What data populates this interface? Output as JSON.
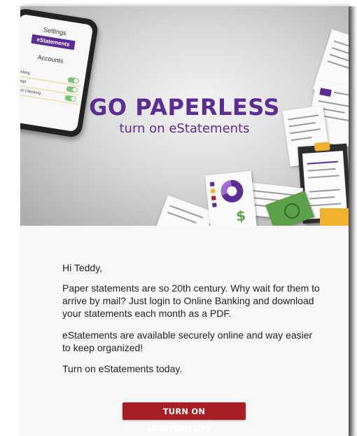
{
  "hero": {
    "title": "GO PAPERLESS",
    "subtitle": "turn on eStatements",
    "phone": {
      "settings_label": "Settings",
      "estatements_label": "eStatements",
      "accounts_label": "Accounts",
      "rows": [
        "Checking",
        "Savings",
        "Interest Checking"
      ]
    }
  },
  "email": {
    "greeting": "Hi Teddy,",
    "paragraphs": [
      "Paper statements are so 20th century. Why wait for them to arrive by mail? Just login to Online Banking and download your statements each month as a PDF.",
      "eStatements are available securely online and way easier to keep organized!",
      "Turn on eStatements today."
    ],
    "cta_label": "TURN ON eSTATEMENTS",
    "cta_icon": "chevron-right-icon"
  },
  "colors": {
    "brand_purple": "#5b2c91",
    "cta_red": "#a82026",
    "money_green": "#5ca04a",
    "accent_yellow": "#f0b22e"
  }
}
